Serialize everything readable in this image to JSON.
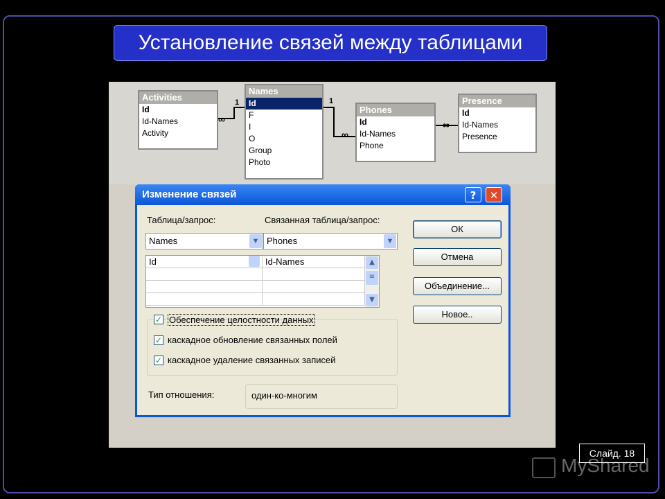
{
  "slide": {
    "title": "Установление связей между таблицами",
    "number_label": "Слайд. 18",
    "watermark": "MyShared"
  },
  "relationships": {
    "tables": [
      {
        "name": "Activities",
        "fields": [
          "Id",
          "Id-Names",
          "Activity"
        ]
      },
      {
        "name": "Names",
        "fields": [
          "Id",
          "F",
          "I",
          "O",
          "Group",
          "Photo"
        ]
      },
      {
        "name": "Phones",
        "fields": [
          "Id",
          "Id-Names",
          "Phone"
        ]
      },
      {
        "name": "Presence",
        "fields": [
          "Id",
          "Id-Names",
          "Presence"
        ]
      }
    ],
    "one_symbol": "1",
    "many_symbol": "∞"
  },
  "dialog": {
    "title": "Изменение связей",
    "help_button": "?",
    "close_button": "✕",
    "table_label": "Таблица/запрос:",
    "related_label": "Связанная таблица/запрос:",
    "table_value": "Names",
    "related_value": "Phones",
    "grid_rows": [
      [
        "Id",
        "Id-Names"
      ],
      [
        "",
        ""
      ],
      [
        "",
        ""
      ],
      [
        "",
        ""
      ]
    ],
    "checkboxes": [
      {
        "label": "Обеспечение целостности данных",
        "checked": true
      },
      {
        "label": "каскадное обновление связанных полей",
        "checked": true
      },
      {
        "label": "каскадное удаление связанных записей",
        "checked": true
      }
    ],
    "relation_type_label": "Тип отношения:",
    "relation_type_value": "один-ко-многим",
    "buttons": {
      "ok": "ОК",
      "cancel": "Отмена",
      "join": "Объединение...",
      "new": "Новое.."
    }
  },
  "colors": {
    "title_bg": "#2430c8",
    "dialog_blue": "#0a56d8",
    "check_green": "#21a121"
  }
}
